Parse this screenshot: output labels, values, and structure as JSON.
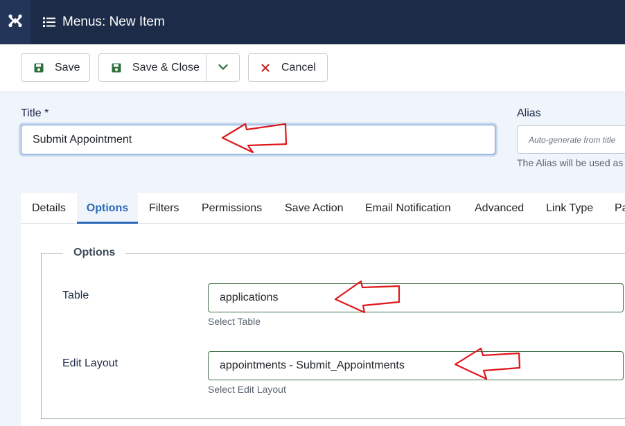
{
  "header": {
    "brand_icon": "joomla-icon",
    "title_icon": "list-icon",
    "title": "Menus: New Item"
  },
  "toolbar": {
    "save_label": "Save",
    "save_close_label": "Save & Close",
    "cancel_label": "Cancel",
    "save_icon_color": "#2f6f3e",
    "cancel_icon_color": "#c52827"
  },
  "form": {
    "title_label": "Title *",
    "title_value": "Submit Appointment",
    "alias_label": "Alias",
    "alias_placeholder": "Auto-generate from title",
    "alias_help": "The Alias will be used as"
  },
  "tabs": [
    {
      "label": "Details"
    },
    {
      "label": "Options"
    },
    {
      "label": "Filters"
    },
    {
      "label": "Permissions"
    },
    {
      "label": "Save Action"
    },
    {
      "label": "Email Notification"
    },
    {
      "label": "Advanced"
    },
    {
      "label": "Link Type"
    },
    {
      "label": "Pa"
    }
  ],
  "active_tab": "Options",
  "options": {
    "legend": "Options",
    "table_label": "Table",
    "table_value": "applications",
    "table_hint": "Select Table",
    "layout_label": "Edit Layout",
    "layout_value": "appointments - Submit_Appointments",
    "layout_hint": "Select Edit Layout"
  },
  "annotation_color": "#e0161b"
}
